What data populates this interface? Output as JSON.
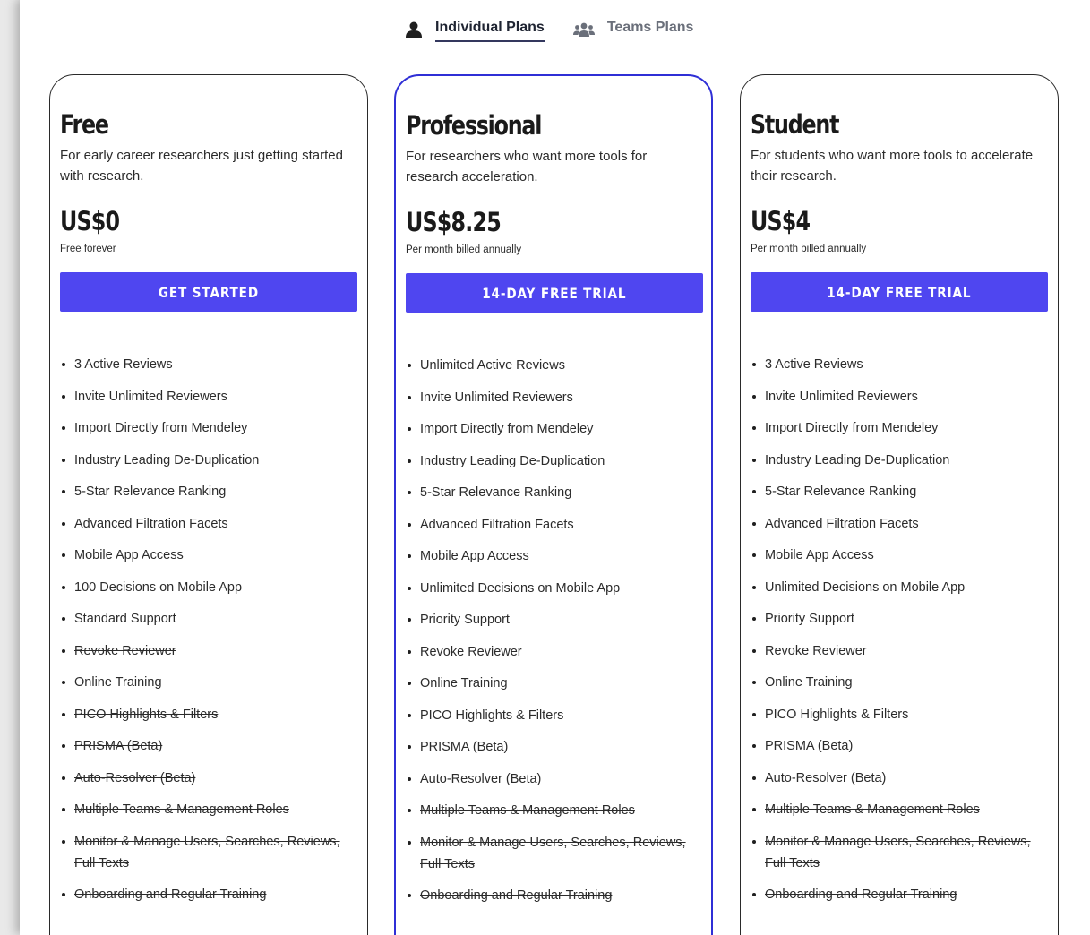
{
  "tabs": [
    {
      "label": "Individual Plans",
      "icon": "user-icon",
      "active": true
    },
    {
      "label": "Teams Plans",
      "icon": "users-icon",
      "active": false
    }
  ],
  "colors": {
    "accent": "#4f46f0",
    "featured_border": "#2f2fd6"
  },
  "plans": [
    {
      "name": "Free",
      "description": "For early career researchers just getting started with research.",
      "price": "US$0",
      "note": "Free forever",
      "cta": "GET STARTED",
      "features": [
        {
          "text": "3 Active Reviews",
          "included": true
        },
        {
          "text": "Invite Unlimited Reviewers",
          "included": true
        },
        {
          "text": "Import Directly from Mendeley",
          "included": true
        },
        {
          "text": "Industry Leading De-Duplication",
          "included": true
        },
        {
          "text": "5-Star Relevance Ranking",
          "included": true
        },
        {
          "text": "Advanced Filtration Facets",
          "included": true
        },
        {
          "text": "Mobile App Access",
          "included": true
        },
        {
          "text": "100 Decisions on Mobile App",
          "included": true
        },
        {
          "text": "Standard Support",
          "included": true
        },
        {
          "text": "Revoke Reviewer",
          "included": false
        },
        {
          "text": "Online Training",
          "included": false
        },
        {
          "text": "PICO Highlights & Filters",
          "included": false
        },
        {
          "text": "PRISMA (Beta)",
          "included": false
        },
        {
          "text": "Auto-Resolver (Beta)",
          "included": false
        },
        {
          "text": "Multiple Teams & Management Roles",
          "included": false
        },
        {
          "text": "Monitor & Manage Users, Searches, Reviews, Full Texts",
          "included": false
        },
        {
          "text": "Onboarding and Regular Training",
          "included": false
        }
      ]
    },
    {
      "name": "Professional",
      "description": "For researchers who want more tools for research acceleration.",
      "price": "US$8.25",
      "note": "Per month billed annually",
      "cta": "14-DAY FREE TRIAL",
      "features": [
        {
          "text": "Unlimited Active Reviews",
          "included": true
        },
        {
          "text": "Invite Unlimited Reviewers",
          "included": true
        },
        {
          "text": "Import Directly from Mendeley",
          "included": true
        },
        {
          "text": "Industry Leading De-Duplication",
          "included": true
        },
        {
          "text": "5-Star Relevance Ranking",
          "included": true
        },
        {
          "text": "Advanced Filtration Facets",
          "included": true
        },
        {
          "text": "Mobile App Access",
          "included": true
        },
        {
          "text": "Unlimited Decisions on Mobile App",
          "included": true
        },
        {
          "text": "Priority Support",
          "included": true
        },
        {
          "text": "Revoke Reviewer",
          "included": true
        },
        {
          "text": "Online Training",
          "included": true
        },
        {
          "text": "PICO Highlights & Filters",
          "included": true
        },
        {
          "text": "PRISMA (Beta)",
          "included": true
        },
        {
          "text": "Auto-Resolver (Beta)",
          "included": true
        },
        {
          "text": "Multiple Teams & Management Roles",
          "included": false
        },
        {
          "text": "Monitor & Manage Users, Searches, Reviews, Full Texts",
          "included": false
        },
        {
          "text": "Onboarding and Regular Training",
          "included": false
        }
      ]
    },
    {
      "name": "Student",
      "description": "For students who want more tools to accelerate their research.",
      "price": "US$4",
      "note": "Per month billed annually",
      "cta": "14-DAY FREE TRIAL",
      "features": [
        {
          "text": "3 Active Reviews",
          "included": true
        },
        {
          "text": "Invite Unlimited Reviewers",
          "included": true
        },
        {
          "text": "Import Directly from Mendeley",
          "included": true
        },
        {
          "text": "Industry Leading De-Duplication",
          "included": true
        },
        {
          "text": "5-Star Relevance Ranking",
          "included": true
        },
        {
          "text": "Advanced Filtration Facets",
          "included": true
        },
        {
          "text": "Mobile App Access",
          "included": true
        },
        {
          "text": "Unlimited Decisions on Mobile App",
          "included": true
        },
        {
          "text": "Priority Support",
          "included": true
        },
        {
          "text": "Revoke Reviewer",
          "included": true
        },
        {
          "text": "Online Training",
          "included": true
        },
        {
          "text": "PICO Highlights & Filters",
          "included": true
        },
        {
          "text": "PRISMA (Beta)",
          "included": true
        },
        {
          "text": "Auto-Resolver (Beta)",
          "included": true
        },
        {
          "text": "Multiple Teams & Management Roles",
          "included": false
        },
        {
          "text": "Monitor & Manage Users, Searches, Reviews, Full Texts",
          "included": false
        },
        {
          "text": "Onboarding and Regular Training",
          "included": false
        }
      ]
    }
  ]
}
